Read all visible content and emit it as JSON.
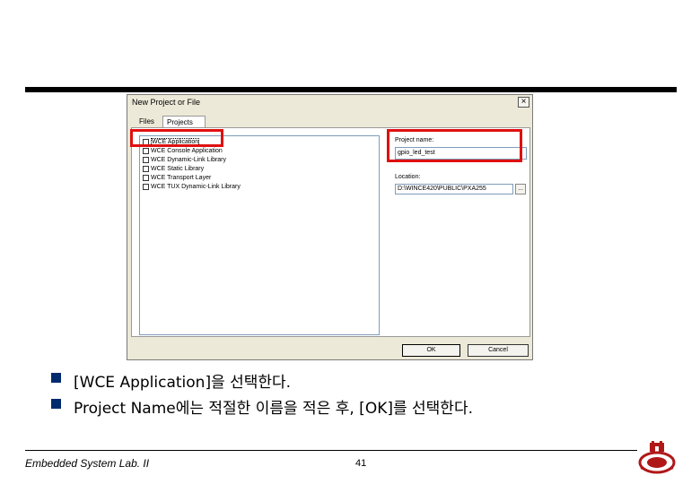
{
  "dialog": {
    "title": "New Project or File",
    "close": "×",
    "tabs": [
      "Files",
      "Projects"
    ],
    "project_types": [
      "WCE Application",
      "WCE Console Application",
      "WCE Dynamic-Link Library",
      "WCE Static Library",
      "WCE Transport Layer",
      "WCE TUX Dynamic-Link Library"
    ],
    "project_name_label": "Project name:",
    "project_name_value": "gpio_led_test",
    "location_label": "Location:",
    "location_value": "D:\\WINCE420\\PUBLIC\\PXA255",
    "browse_label": "...",
    "ok_label": "OK",
    "cancel_label": "Cancel"
  },
  "bullets": [
    "[WCE Application]을 선택한다.",
    "Project Name에는 적절한 이름을 적은 후, [OK]를 선택한다."
  ],
  "footer": {
    "title": "Embedded System Lab. II",
    "page_number": "41"
  },
  "colors": {
    "highlight": "#e01010",
    "bullet": "#002a6e"
  }
}
